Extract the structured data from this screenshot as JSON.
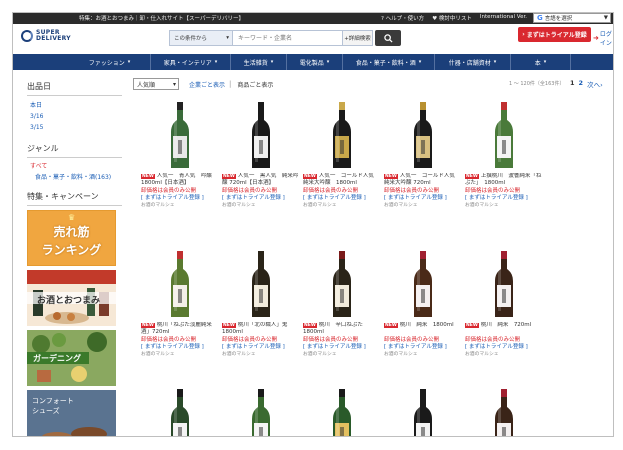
{
  "topbar": {
    "notice": "特集：お酒とおつまみ｜卸・仕入れサイト【スーパーデリバリー】",
    "help": "ヘルプ・使い方",
    "wishlist": "検討中リスト",
    "intl": "International Ver.",
    "lang_label": "言語を選択"
  },
  "header": {
    "logo_line1": "SUPER",
    "logo_line2": "DELIVERY",
    "scope": "この条件から",
    "search_placeholder": "キーワード・企業名",
    "advanced": "+詳細検索",
    "trial_button": "まずはトライアル登録",
    "login": "ログイン"
  },
  "nav": [
    {
      "label": "ファッション",
      "w": 82
    },
    {
      "label": "家具・インテリア",
      "w": 80
    },
    {
      "label": "生活雑貨",
      "w": 56
    },
    {
      "label": "電化製品",
      "w": 56
    },
    {
      "label": "食品・菓子・飲料・酒",
      "w": 92
    },
    {
      "label": "什器・店舗資材",
      "w": 76
    },
    {
      "label": "本",
      "w": 60
    }
  ],
  "sidebar": {
    "date_heading": "出品日",
    "dates": [
      "本日",
      "3/16",
      "3/15"
    ],
    "genre_heading": "ジャンル",
    "genre_all": "すべて",
    "genre_item": "食品・菓子・飲料・酒(163)",
    "campaign_heading": "特集・キャンペーン",
    "banner1_line1": "売れ筋",
    "banner1_line2": "ランキング",
    "banner2_line1": "お酒とおつまみ",
    "banner3_line1": "ガーデニング",
    "banner4_line1": "コンフォート",
    "banner4_line2": "シューズ"
  },
  "toolbar": {
    "sort": "人気順",
    "view_company": "企業ごと表示",
    "view_product": "商品ごと表示",
    "count": "1 ～ 120件（全163件）",
    "page1": "1",
    "page2": "2",
    "next": "次へ"
  },
  "products": [
    {
      "title": "人気一　青人気　吟醸　1800ml【日本酒】",
      "new": true
    },
    {
      "title": "人気一　黒人気　純米吟醸 720ml【日本酒】",
      "new": true
    },
    {
      "title": "人気一　ゴールド人気　純米大吟醸　1800ml",
      "new": true
    },
    {
      "title": "人気一　ゴールド人気　純米大吟醸 720ml",
      "new": true
    },
    {
      "title": "上撰桃川　波響純米「ねぶた」　1800ml",
      "new": true
    },
    {
      "title": "桃川「ねぶた淡麗純米酒」720ml",
      "new": true
    },
    {
      "title": "桃川「北の職人」鬼　1800ml",
      "new": true
    },
    {
      "title": "桃川　辛口ねぶた　1800ml",
      "new": true
    },
    {
      "title": "桃川　純米　1800ml",
      "new": true
    },
    {
      "title": "桃川　純米　720ml",
      "new": true
    }
  ],
  "product_common": {
    "new_badge": "NEW",
    "price": "卸価格は会員のみ公開",
    "trial": "[ まずはトライアル登録 ]",
    "seller": "お酒のマルシェ"
  },
  "bottles": [
    {
      "glass": "#3a6b3a",
      "label": "#e8e8e8",
      "cap": "#222222"
    },
    {
      "glass": "#1a1a1a",
      "label": "#f0f0f0",
      "cap": "#1a1a1a"
    },
    {
      "glass": "#1a1a1a",
      "label": "#c9a84a",
      "cap": "#c9a84a"
    },
    {
      "glass": "#1a1a1a",
      "label": "#d8c080",
      "cap": "#b89030"
    },
    {
      "glass": "#4a7a3a",
      "label": "#f4f4f4",
      "cap": "#c03030"
    },
    {
      "glass": "#5a7a30",
      "label": "#f4f0e8",
      "cap": "#c03030"
    },
    {
      "glass": "#2a2418",
      "label": "#f2ecdc",
      "cap": "#2a2418"
    },
    {
      "glass": "#2a2418",
      "label": "#f2ecdc",
      "cap": "#7a1a1a"
    },
    {
      "glass": "#4a2a18",
      "label": "#f4f0f0",
      "cap": "#a02030"
    },
    {
      "glass": "#3a2418",
      "label": "#f4f0f0",
      "cap": "#a02030"
    },
    {
      "glass": "#2a4a2a",
      "label": "#f4f4f4",
      "cap": "#1a1a1a"
    },
    {
      "glass": "#3a6a30",
      "label": "#f4f4f4",
      "cap": "#1a1a1a"
    },
    {
      "glass": "#2a5a2a",
      "label": "#e4c060",
      "cap": "#1a1a1a"
    },
    {
      "glass": "#1a1a1a",
      "label": "#f4f4f4",
      "cap": "#1a1a1a"
    },
    {
      "glass": "#3a2418",
      "label": "#f4f0f0",
      "cap": "#a02030"
    }
  ],
  "colors": {
    "nav_bg": "#1b3f7a",
    "accent_red": "#d9282f",
    "link_blue": "#1a5db5"
  }
}
